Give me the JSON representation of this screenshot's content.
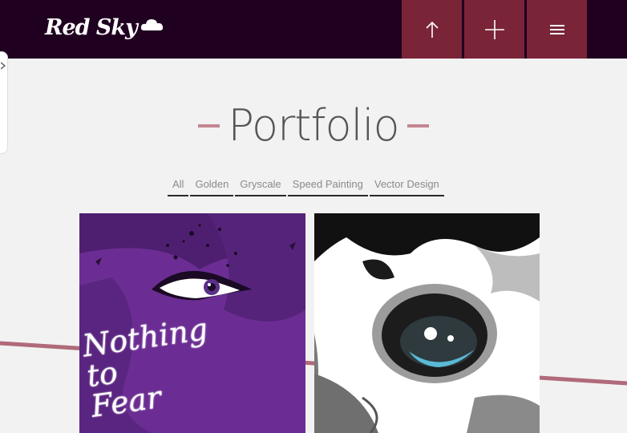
{
  "header": {
    "logo_text": "Red Sky",
    "logo_icon": "cloud-icon",
    "buttons": [
      {
        "icon": "arrow-up-icon"
      },
      {
        "icon": "plus-icon"
      },
      {
        "icon": "hamburger-menu-icon"
      }
    ],
    "background_color": "#200020",
    "button_color": "#7a2438"
  },
  "side_panel": {
    "icon": "gear-icon"
  },
  "portfolio": {
    "title": "Portfolio",
    "accent_color": "#c48591",
    "filters": [
      "All",
      "Golden",
      "Gryscale",
      "Speed Painting",
      "Vector Design"
    ],
    "items": [
      {
        "caption": "Nothing to Fear",
        "image": "purple-illustrated-face"
      },
      {
        "caption": "",
        "image": "grayscale-masked-face"
      }
    ]
  }
}
